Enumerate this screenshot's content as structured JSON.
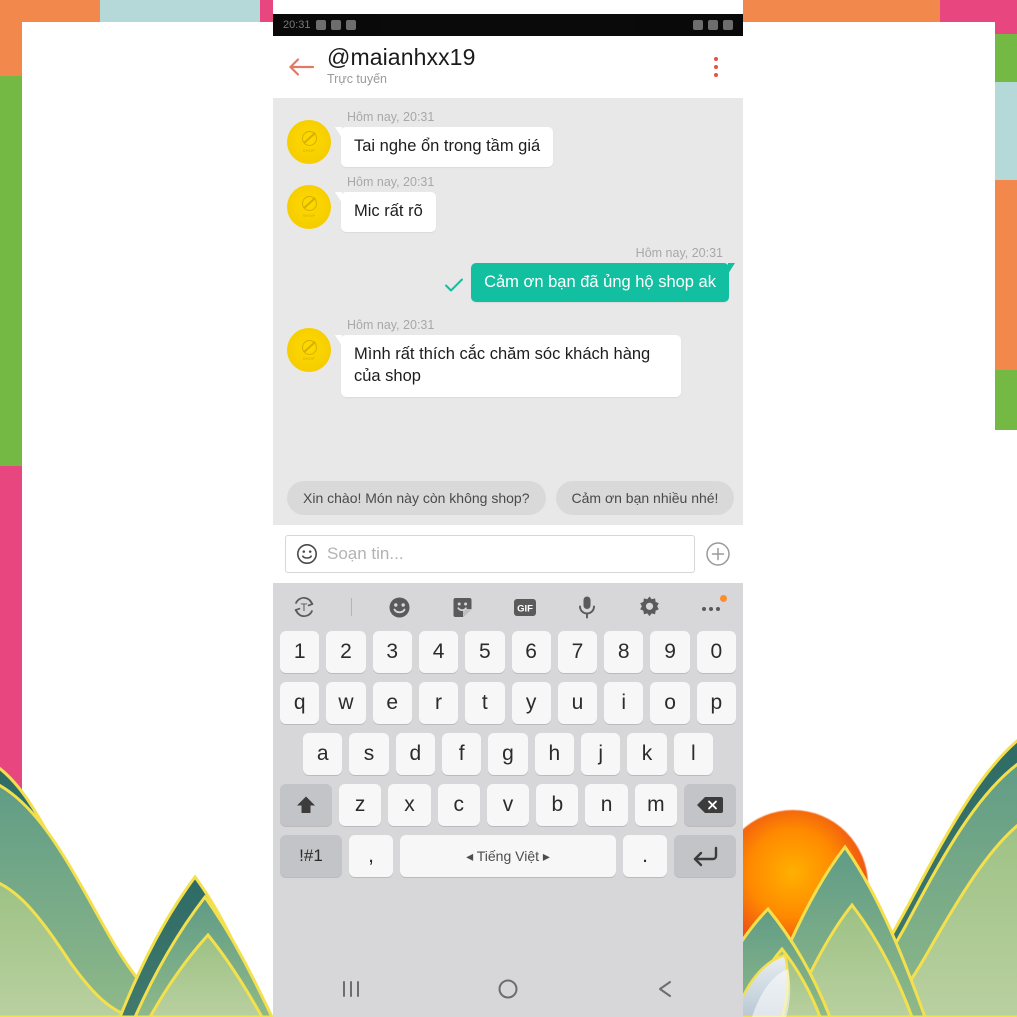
{
  "statusbar": {
    "time": "20:31",
    "carrier": ""
  },
  "header": {
    "back_icon": "arrow-left-icon",
    "title": "@maianhxx19",
    "subtitle": "Trực tuyến",
    "menu_icon": "overflow-menu-icon"
  },
  "messages": [
    {
      "side": "in",
      "time": "Hôm nay, 20:31",
      "text": "Tai nghe ổn trong tầm giá",
      "avatar": "shop-avatar"
    },
    {
      "side": "in",
      "time": "Hôm nay, 20:31",
      "text": "Mic rất rõ",
      "avatar": "shop-avatar"
    },
    {
      "side": "out",
      "time": "Hôm nay, 20:31",
      "text": "Cảm ơn bạn đã ủng hộ shop ak",
      "status_icon": "check-icon"
    },
    {
      "side": "in",
      "time": "Hôm nay, 20:31",
      "text": "Mình rất thích cắc chăm sóc khách hàng của shop",
      "avatar": "shop-avatar"
    }
  ],
  "suggestions": [
    "Xin chào! Món này còn không shop?",
    "Cảm ơn bạn nhiều nhé!"
  ],
  "input": {
    "emoji_icon": "smiley-icon",
    "placeholder": "Soạn tin...",
    "value": "",
    "attach_icon": "plus-circle-icon"
  },
  "keyboard": {
    "tools": [
      "translate-icon",
      "divider",
      "emoji-icon",
      "sticker-icon",
      "gif-icon",
      "microphone-icon",
      "settings-icon",
      "more-icon"
    ],
    "gif_label": "GIF",
    "rows": {
      "numbers": [
        "1",
        "2",
        "3",
        "4",
        "5",
        "6",
        "7",
        "8",
        "9",
        "0"
      ],
      "top": [
        "q",
        "w",
        "e",
        "r",
        "t",
        "y",
        "u",
        "i",
        "o",
        "p"
      ],
      "home": [
        "a",
        "s",
        "d",
        "f",
        "g",
        "h",
        "j",
        "k",
        "l"
      ],
      "bottom": [
        "z",
        "x",
        "c",
        "v",
        "b",
        "n",
        "m"
      ]
    },
    "shift_label": "shift-icon",
    "backspace_label": "backspace-icon",
    "symbols_label": "!#1",
    "comma_label": ",",
    "space_label": "◂ Tiếng Việt ▸",
    "period_label": ".",
    "enter_label": "enter-icon"
  },
  "navbar": {
    "recents_icon": "recents-icon",
    "home_icon": "home-icon",
    "back_icon": "back-icon"
  },
  "colors": {
    "accent_teal": "#12bfa0",
    "avatar_yellow": "#f5cd00",
    "back_arrow": "#e07a65",
    "menu_dot": "#e8533f",
    "chat_bg": "#e8e8e8",
    "chip_bg": "#d9d9d9",
    "keyboard_bg": "#d7d7d9",
    "key_bg": "#f7f7f7",
    "key_fn_bg": "#c3c4c7",
    "badge_orange": "#ff8c2b",
    "deco_orange": "#f2884c",
    "deco_lightblue": "#b5d9d8",
    "deco_pink": "#e8467f",
    "deco_green": "#74b944",
    "deco_lightorange": "#f8ab6a",
    "sun_orange": "#f05a12"
  }
}
